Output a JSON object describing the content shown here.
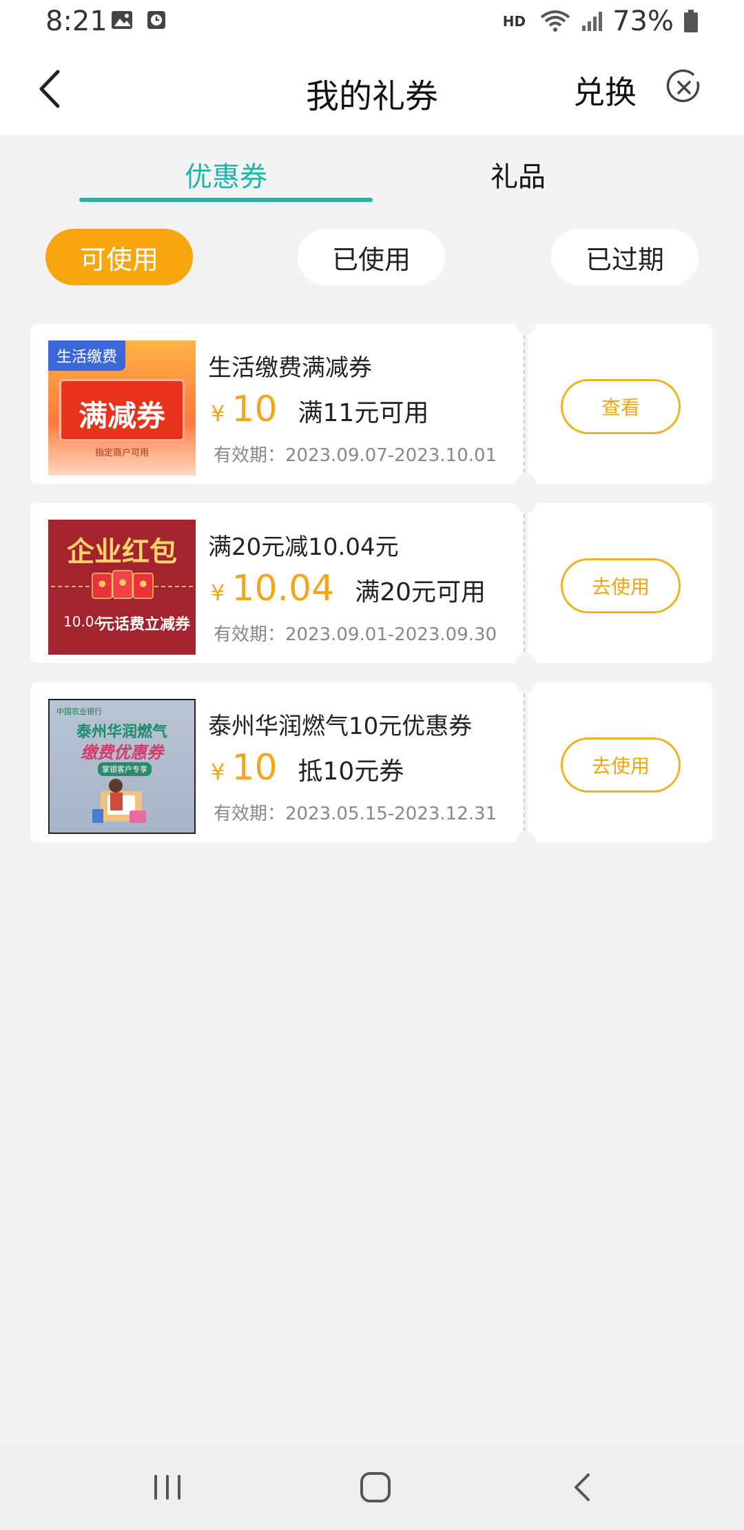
{
  "status_bar": {
    "time": "8:21",
    "network": "HD",
    "battery": "73%",
    "icons": [
      "image-icon",
      "clock-icon",
      "wifi-icon",
      "signal-icon",
      "battery-icon"
    ]
  },
  "header": {
    "title": "我的礼券",
    "exchange_label": "兑换",
    "back_icon": "chevron-left-icon",
    "close_icon": "circle-close-icon"
  },
  "tabs": [
    {
      "label": "优惠券",
      "active": true
    },
    {
      "label": "礼品",
      "active": false
    }
  ],
  "filters": [
    {
      "label": "可使用",
      "active": true
    },
    {
      "label": "已使用",
      "active": false
    },
    {
      "label": "已过期",
      "active": false
    }
  ],
  "coupons": [
    {
      "title": "生活缴费满减券",
      "currency": "¥",
      "amount": "10",
      "condition": "满11元可用",
      "validity": "有效期：2023.09.07-2023.10.01",
      "button": "查看",
      "thumb": {
        "badge": "生活缴费",
        "headline": "满减券",
        "sub": "指定商户可用"
      }
    },
    {
      "title": "满20元减10.04元",
      "currency": "¥",
      "amount": "10.04",
      "condition": "满20元可用",
      "validity": "有效期：2023.09.01-2023.09.30",
      "button": "去使用",
      "thumb": {
        "headline": "企业红包",
        "sub_number": "10.04",
        "sub": "元话费立减券"
      }
    },
    {
      "title": "泰州华润燃气10元优惠券",
      "currency": "¥",
      "amount": "10",
      "condition": "抵10元券",
      "validity": "有效期：2023.05.15-2023.12.31",
      "button": "去使用",
      "thumb": {
        "bank": "中国农业银行",
        "line1": "泰州华润燃气",
        "line2": "缴费优惠券",
        "tag": "掌银客户专享"
      }
    }
  ],
  "colors": {
    "accent_teal": "#1fb6a8",
    "accent_orange": "#f8a60e",
    "amount_orange": "#f4a61a",
    "background": "#f3f3f3"
  },
  "nav": {
    "icons": [
      "recent-apps-icon",
      "home-icon",
      "back-icon"
    ]
  }
}
